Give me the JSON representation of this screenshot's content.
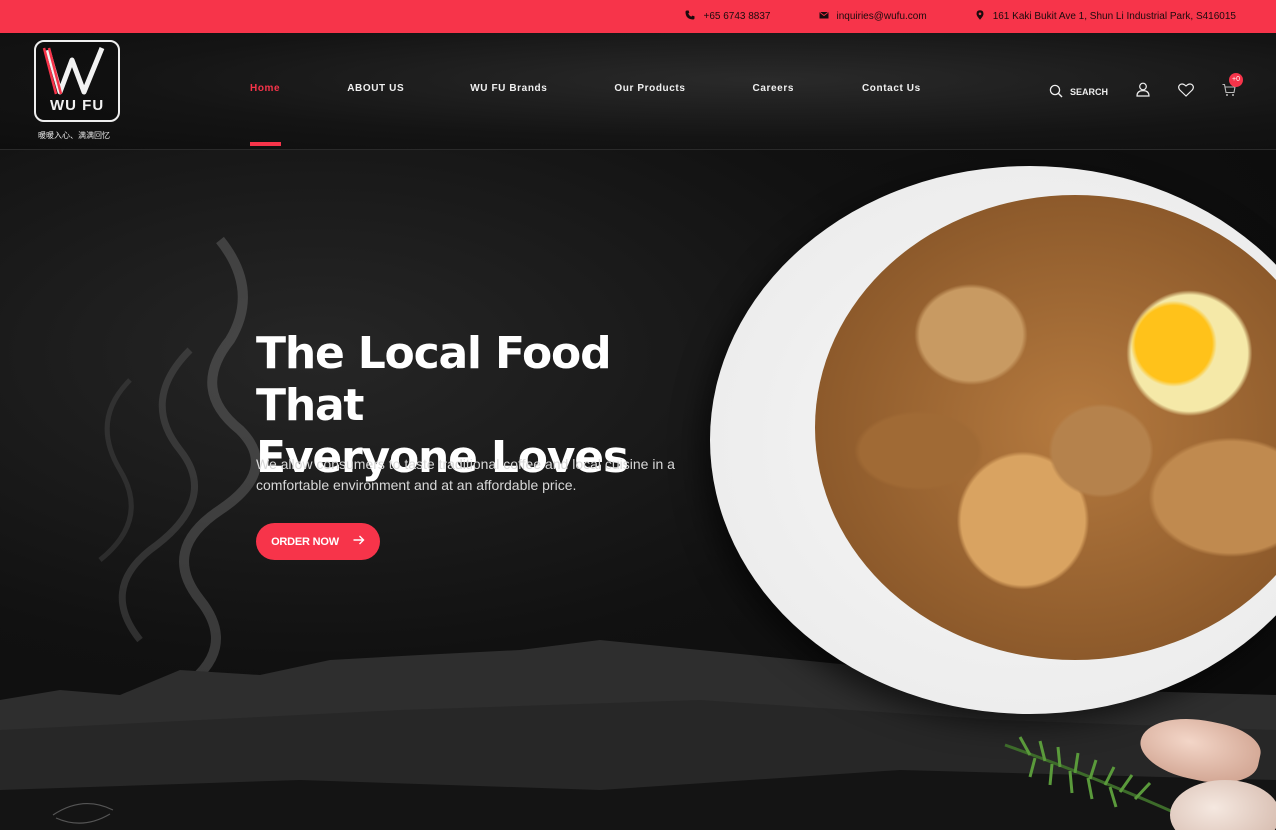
{
  "topbar": {
    "phone": "+65 6743 8837",
    "email": "inquiries@wufu.com",
    "address": "161 Kaki Bukit Ave 1, Shun Li Industrial Park, S416015"
  },
  "logo": {
    "brand": "WU FU",
    "tagline": "暖暖入心、满满回忆"
  },
  "nav": {
    "items": [
      {
        "label": "Home",
        "active": true
      },
      {
        "label": "ABOUT US"
      },
      {
        "label": "WU FU Brands"
      },
      {
        "label": "Our Products"
      },
      {
        "label": "Careers"
      },
      {
        "label": "Contact Us"
      }
    ]
  },
  "tools": {
    "search_label": "SEARCH",
    "cart_count": "+0"
  },
  "hero": {
    "headline_line1": "The Local Food That",
    "headline_line2": "Everyone Loves",
    "description": "We allow consumers to taste traditional coffee and local cuisine in a comfortable environment and at an affordable price.",
    "cta_label": "ORDER NOW"
  },
  "colors": {
    "accent": "#f7344a",
    "background": "#0d0d0d"
  },
  "icons": [
    "phone-icon",
    "mail-icon",
    "location-icon",
    "search-icon",
    "user-icon",
    "heart-icon",
    "cart-icon",
    "arrow-right-icon"
  ]
}
